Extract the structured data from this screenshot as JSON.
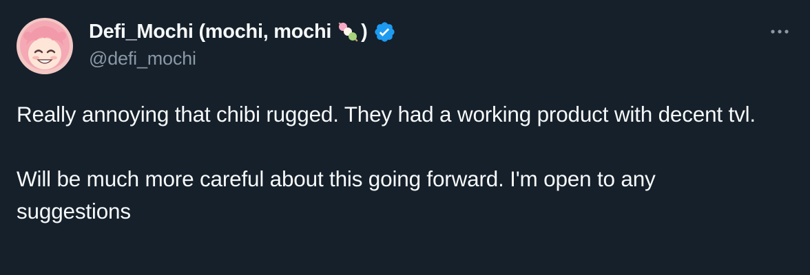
{
  "author": {
    "display_name": "Defi_Mochi (mochi, mochi",
    "name_suffix": ")",
    "name_emoji": "dango-icon",
    "verified": true,
    "verified_color": "#1d9bf0",
    "handle": "@defi_mochi",
    "avatar": "anime-girl-avatar"
  },
  "tweet": {
    "paragraphs": [
      "Really annoying that chibi rugged. They had a working product with decent tvl.",
      "Will be much more careful about this going forward. I'm open to any suggestions"
    ]
  },
  "more_menu": {
    "icon": "more-horizontal-icon"
  },
  "colors": {
    "background": "#15202b",
    "text_primary": "#f7f9f9",
    "text_secondary": "#8b98a5"
  }
}
